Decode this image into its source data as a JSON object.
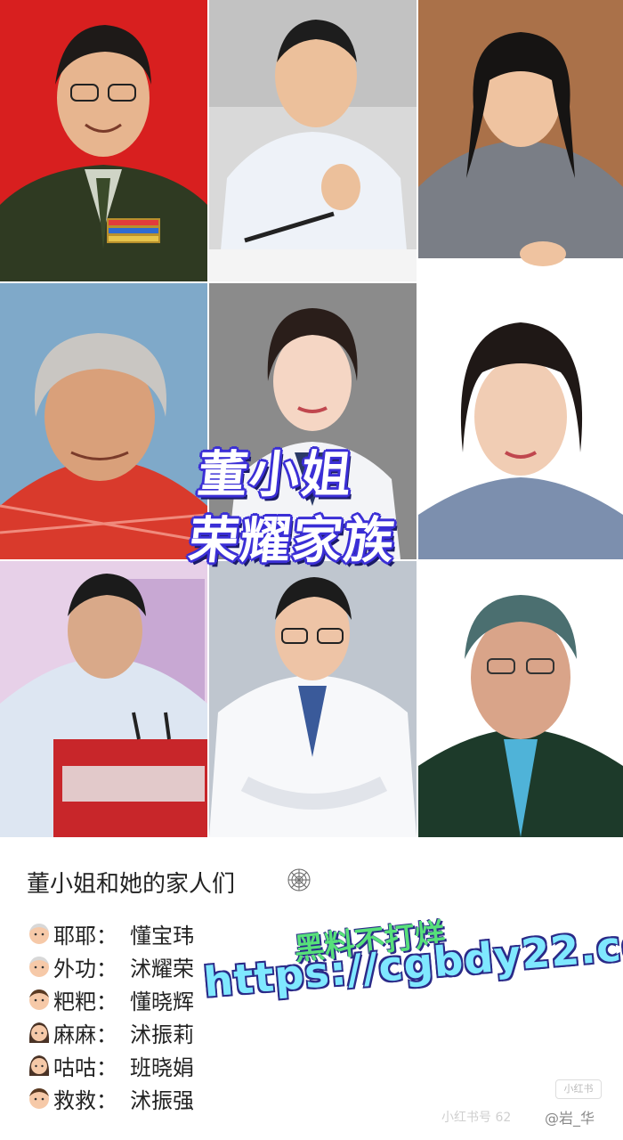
{
  "overlay": {
    "line1": "董小姐",
    "line2": "荣耀家族"
  },
  "caption": {
    "title": "董小姐和她的家人们",
    "title_icon": "spider-web-icon",
    "rows": [
      {
        "icon": "old-man-emoji",
        "relation": "耶耶：",
        "name": "懂宝玮"
      },
      {
        "icon": "old-man-emoji",
        "relation": "外功：",
        "name": "沭耀荣"
      },
      {
        "icon": "man-emoji",
        "relation": "粑粑：",
        "name": "懂晓辉"
      },
      {
        "icon": "woman-emoji",
        "relation": "麻麻：",
        "name": "沭振莉"
      },
      {
        "icon": "woman-emoji",
        "relation": "咕咕：",
        "name": "班晓娟"
      },
      {
        "icon": "man-emoji",
        "relation": "救救：",
        "name": "沭振强"
      }
    ]
  },
  "watermark": {
    "line1": "黑料不打烊",
    "line2": "https://cgbdy22.com"
  },
  "footer": {
    "badge": "小红书",
    "faint_text": "小红书号 62",
    "weibo": "@岩_华"
  },
  "colors": {
    "overlay_fill": "#ffffff",
    "overlay_outline": "#3b2fd6",
    "watermark_green": "#57e07a",
    "watermark_cyan": "#7fe8ff"
  }
}
